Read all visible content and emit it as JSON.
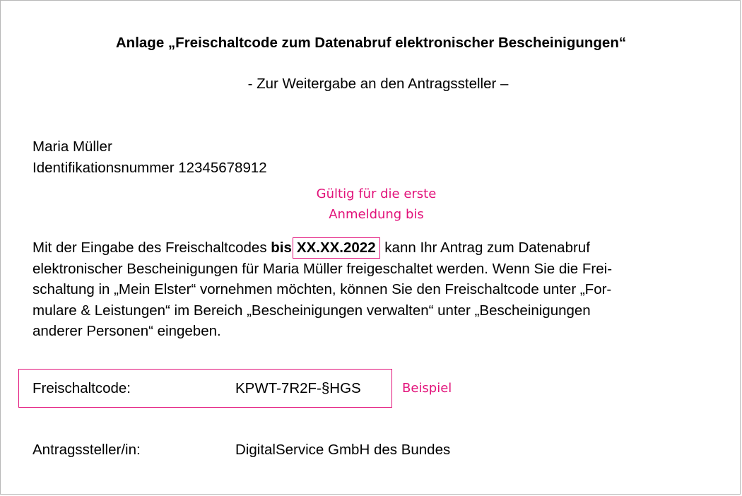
{
  "document": {
    "title": "Anlage „Freischaltcode zum Datenabruf elektronischer Bescheinigungen“",
    "subtitle": "- Zur Weitergabe an den Antragssteller –",
    "person": {
      "name": "Maria Müller",
      "id_line": "Identifikationsnummer 12345678912"
    },
    "annotations": {
      "valid_line1": "Gültig für die erste",
      "valid_line2": "Anmeldung bis",
      "example": "Beispiel"
    },
    "body": {
      "line1_before": "Mit der Eingabe des Freischaltcodes ",
      "line1_bold": "bis",
      "line1_date": "XX.XX.2022",
      "line1_after": " kann Ihr Antrag zum Datenabruf",
      "line2": "elektronischer Bescheinigungen für Maria Müller freigeschaltet werden. Wenn Sie die Frei-",
      "line3": "schaltung in „Mein Elster“ vornehmen möchten, können Sie den Freischaltcode unter „For-",
      "line4": "mulare & Leistungen“ im Bereich „Bescheinigungen verwalten“ unter „Bescheinigungen",
      "line5": "anderer Personen“ eingeben."
    },
    "code": {
      "label": "Freischaltcode:",
      "value": "KPWT-7R2F-§HGS"
    },
    "applicant": {
      "label": "Antragssteller/in:",
      "value": "DigitalService GmbH des Bundes"
    }
  },
  "colors": {
    "accent": "#e2127a",
    "border": "#b7b7b7",
    "text": "#000000"
  }
}
